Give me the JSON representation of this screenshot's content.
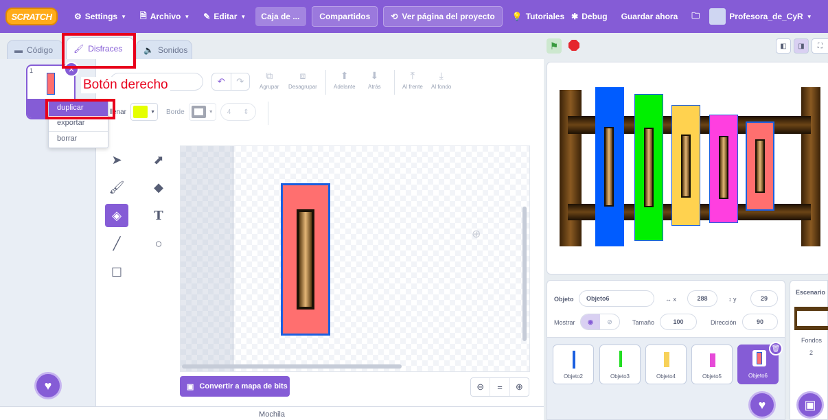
{
  "menubar": {
    "logo": "SCRATCH",
    "settings": "Settings",
    "file": "Archivo",
    "edit": "Editar",
    "project_title": "Caja de ...",
    "shared": "Compartidos",
    "project_page": "Ver página del proyecto",
    "tutorials": "Tutoriales",
    "debug": "Debug",
    "save_now": "Guardar ahora",
    "user": "Profesora_de_CyR"
  },
  "tabs": {
    "code": "Código",
    "costumes": "Disfraces",
    "sounds": "Sonidos"
  },
  "costume_list": {
    "number": "1",
    "name_truncated": "di",
    "size_truncated": "4"
  },
  "context_menu": {
    "duplicate": "duplicar",
    "export": "exportar",
    "delete": "borrar"
  },
  "annotation": "Botón derecho",
  "toolbar": {
    "group": "Agrupar",
    "ungroup": "Desagrupar",
    "forward": "Adelante",
    "backward": "Atrás",
    "front": "Al frente",
    "back": "Al fondo",
    "fill_label": "Rellenar",
    "fill_visible": "llenar",
    "fill_color": "#e5ff00",
    "outline_label": "Borde",
    "outline_size": "4"
  },
  "canvas": {
    "costume_fill": "#ff6f6f",
    "costume_border": "#1b5fe0"
  },
  "bottom": {
    "convert_bitmap": "Convertir a mapa de bits",
    "backpack": "Mochila"
  },
  "sprite_info": {
    "sprite_label": "Objeto",
    "sprite_name": "Objeto6",
    "x_label": "x",
    "x": "288",
    "y_label": "y",
    "y": "29",
    "show_label": "Mostrar",
    "size_label": "Tamaño",
    "size": "100",
    "direction_label": "Dirección",
    "direction": "90"
  },
  "sprites": [
    {
      "name": "Objeto2",
      "color": "#1b5fe0"
    },
    {
      "name": "Objeto3",
      "color": "#22dd22"
    },
    {
      "name": "Objeto4",
      "color": "#f7d159"
    },
    {
      "name": "Objeto5",
      "color": "#e64ad8"
    },
    {
      "name": "Objeto6",
      "color": "#ff6f6f"
    }
  ],
  "scene": {
    "title": "Escenario",
    "backdrops_label": "Fondos",
    "backdrops_count": "2"
  }
}
